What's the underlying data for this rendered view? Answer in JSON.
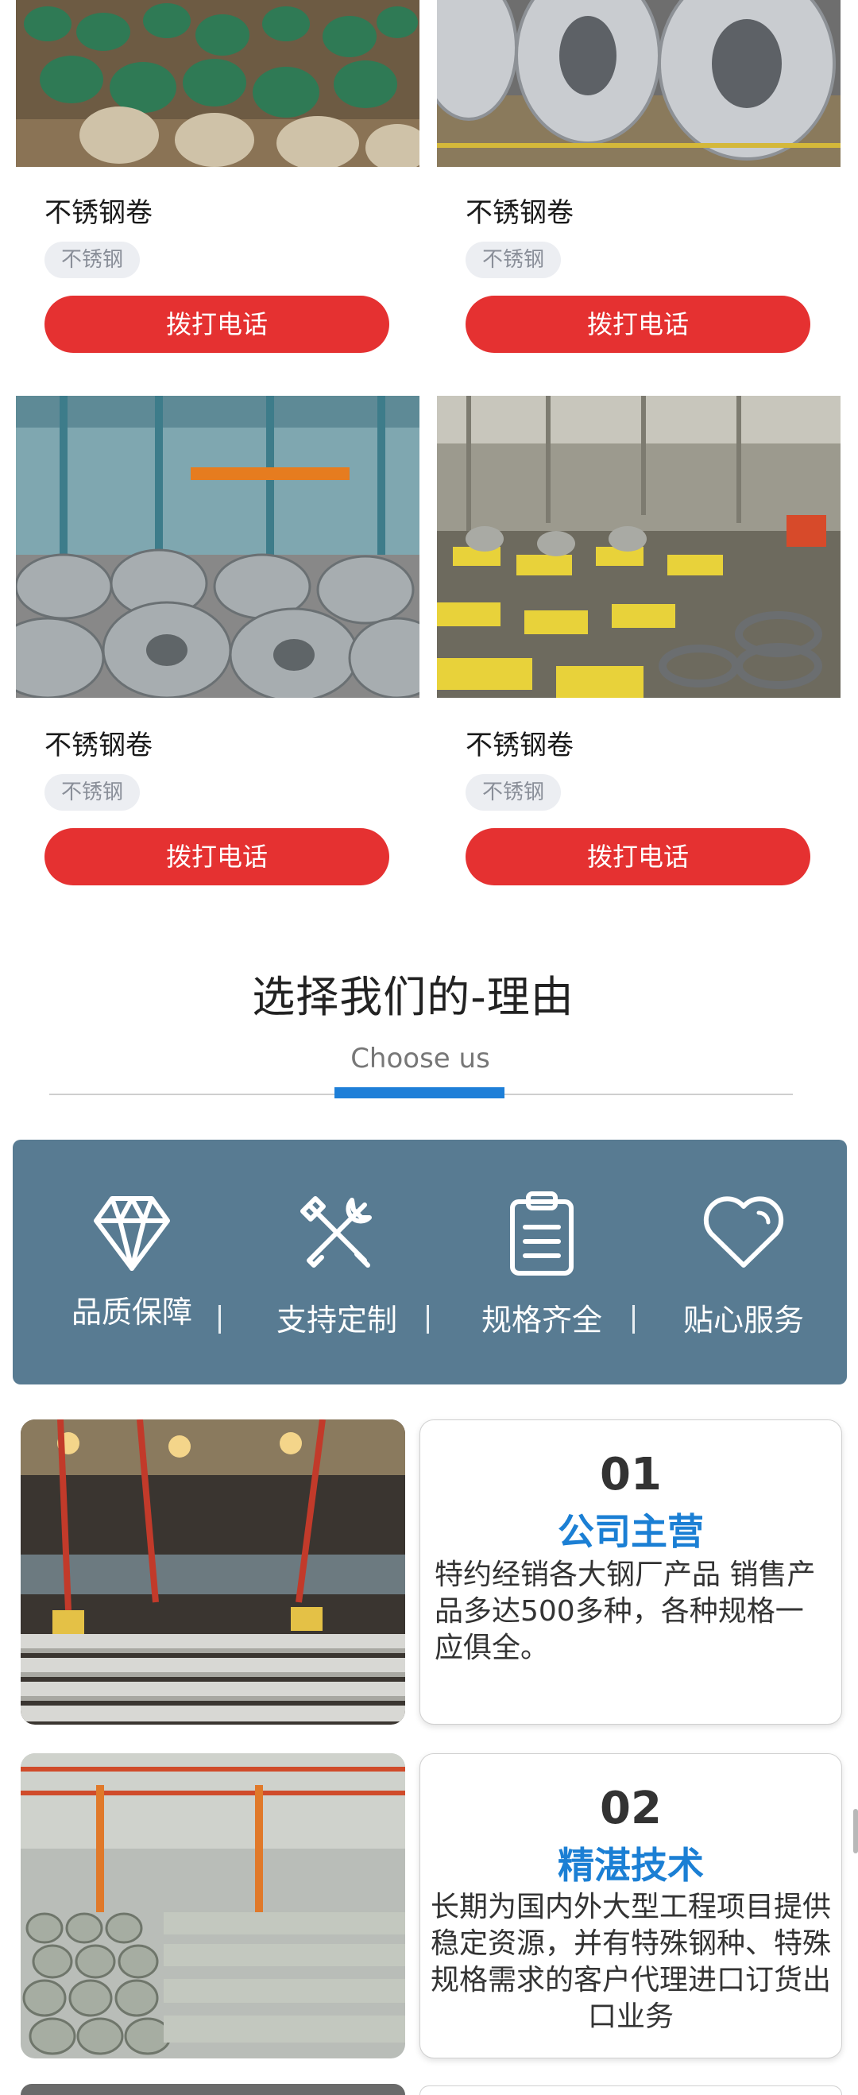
{
  "products": [
    {
      "title": "不锈钢卷",
      "tag": "不锈钢",
      "button": "拨打电话"
    },
    {
      "title": "不锈钢卷",
      "tag": "不锈钢",
      "button": "拨打电话"
    },
    {
      "title": "不锈钢卷",
      "tag": "不锈钢",
      "button": "拨打电话"
    },
    {
      "title": "不锈钢卷",
      "tag": "不锈钢",
      "button": "拨打电话"
    }
  ],
  "reasons_section": {
    "title": "选择我们的-理由",
    "subtitle": "Choose us"
  },
  "reasons": [
    {
      "label": "品质保障",
      "icon": "diamond-icon"
    },
    {
      "label": "支持定制",
      "icon": "tools-icon"
    },
    {
      "label": "规格齐全",
      "icon": "clipboard-icon"
    },
    {
      "label": "贴心服务",
      "icon": "heart-icon"
    }
  ],
  "features": [
    {
      "number": "01",
      "heading": "公司主营",
      "body": "特约经销各大钢厂产品 销售产品多达500多种，各种规格一应俱全。"
    },
    {
      "number": "02",
      "heading": "精湛技术",
      "body": "长期为国内外大型工程项目提供稳定资源，并有特殊钢种、特殊规格需求的客户代理进口订货出口业务"
    }
  ],
  "colors": {
    "call_button": "#e53131",
    "reason_bar": "#587b92",
    "accent_blue": "#1e7fd8"
  }
}
